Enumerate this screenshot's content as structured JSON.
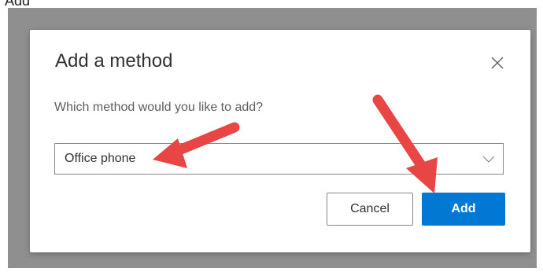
{
  "top_peek": {
    "label": "Add"
  },
  "dialog": {
    "title": "Add a method",
    "question": "Which method would you like to add?",
    "select": {
      "value": "Office phone"
    },
    "cancel_label": "Cancel",
    "add_label": "Add"
  },
  "colors": {
    "primary": "#0078d4",
    "annotation_arrow": "#e84545",
    "backdrop": "#8f8f8f"
  },
  "icons": {
    "close": "close-icon",
    "dropdown": "chevron-down-icon"
  }
}
